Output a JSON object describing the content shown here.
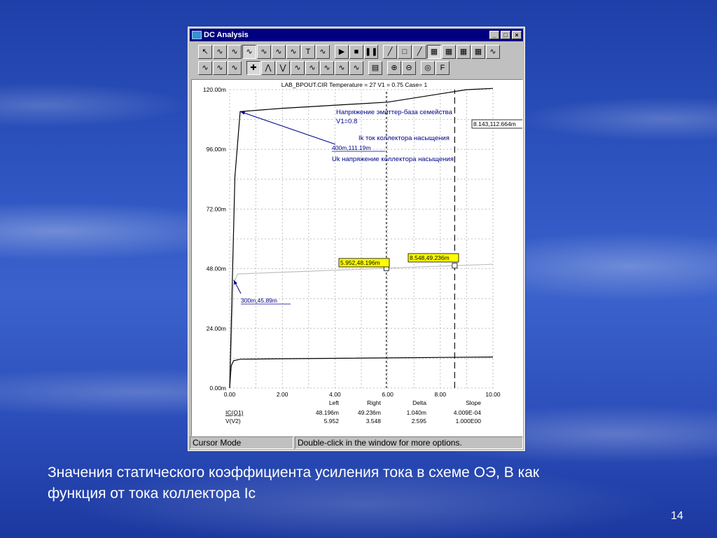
{
  "window": {
    "title": "DC Analysis",
    "controls": {
      "minimize": "_",
      "maximize": "□",
      "close": "×"
    }
  },
  "toolbar_row1": [
    "pointer-icon",
    "tool-icon",
    "tool-icon",
    "tool-icon",
    "tool-icon",
    "tool-icon",
    "tool-icon",
    "text-icon",
    "tool-icon",
    "play-icon",
    "stop-icon",
    "pause-icon",
    "line-icon",
    "box-icon",
    "line-icon",
    "grid-icon",
    "grid-icon",
    "grid-icon",
    "grid-icon",
    "tool-icon"
  ],
  "toolbar_row2": [
    "tool-icon",
    "tool-icon",
    "tool-icon",
    "cursor-icon",
    "peak-icon",
    "valley-icon",
    "tool-icon",
    "tool-icon",
    "tool-icon",
    "tool-icon",
    "tool-icon",
    "table-icon",
    "zoom-in-icon",
    "zoom-out-icon",
    "globe-icon",
    "font-icon"
  ],
  "chart_data": {
    "type": "line",
    "title": "LAB_BPOUT.CIR Temperature = 27 V1 = 0.75 Case= 1",
    "xlim": [
      0,
      10
    ],
    "ylim": [
      0,
      120
    ],
    "x_ticks": [
      "0.00",
      "2.00",
      "4.00",
      "6.00",
      "8.00",
      "10.00"
    ],
    "y_ticks": [
      "0.00m",
      "24.00m",
      "48.00m",
      "72.00m",
      "96.00m",
      "120.00m"
    ],
    "grid": true,
    "series": [
      {
        "points": [
          [
            0,
            0
          ],
          [
            0.06,
            9
          ],
          [
            0.15,
            11
          ],
          [
            0.4,
            11.6
          ],
          [
            2,
            11.8
          ],
          [
            10,
            12.5
          ]
        ],
        "color": "#000000"
      },
      {
        "points": [
          [
            0,
            0
          ],
          [
            0.15,
            42
          ],
          [
            0.3,
            45.89
          ],
          [
            2,
            46.6
          ],
          [
            5.952,
            48.196
          ],
          [
            8.548,
            49.236
          ],
          [
            10,
            49.8
          ]
        ],
        "color": "#c0c0c0"
      },
      {
        "points": [
          [
            0,
            0
          ],
          [
            0.2,
            85
          ],
          [
            0.4,
            111.19
          ],
          [
            2,
            112.5
          ],
          [
            6,
            115
          ],
          [
            9,
            120
          ],
          [
            10,
            120.5
          ]
        ],
        "color": "#000000"
      }
    ],
    "cursors": [
      {
        "x": 5.952,
        "style": "short-dash"
      },
      {
        "x": 8.548,
        "style": "long-dash"
      }
    ],
    "markers": [
      {
        "x": 5.952,
        "y": 48.196
      },
      {
        "x": 8.548,
        "y": 49.236
      }
    ],
    "labels": [
      {
        "text": "5.952,48.196m",
        "x": 5.952,
        "y": 48.196,
        "highlight": true
      },
      {
        "text": "8.548,49.236m",
        "x": 8.548,
        "y": 49.236,
        "highlight": true
      },
      {
        "text": "8.143,112.664m",
        "x": 8.143,
        "y": 112.664,
        "highlight": false
      },
      {
        "text": "400m,111.19m",
        "x": 0.4,
        "y": 111.19,
        "highlight": false
      },
      {
        "text": "300m,45.89m",
        "x": 0.3,
        "y": 45.89,
        "highlight": false
      }
    ],
    "annotations": [
      "Напряжение эмиттер-база семейства",
      "V1=0.8",
      "Ik ток коллектора насыщения",
      "Uk напряжение коллектора насыщения"
    ],
    "table": {
      "headers": [
        "",
        "Left",
        "Right",
        "Delta",
        "Slope"
      ],
      "rows": [
        [
          "IC(Q1)",
          "48.196m",
          "49.236m",
          "1.040m",
          "4.009E-04"
        ],
        [
          "V(V2)",
          "5.952",
          "3.548",
          "2.595",
          "1.000E00"
        ]
      ]
    }
  },
  "status": {
    "mode": "Cursor Mode",
    "hint": "Double-click in the window for more options."
  },
  "slide": {
    "caption_line1": "Значения статического коэффициента усиления тока в схеме ОЭ, В как",
    "caption_line2": "функция от тока коллектора Ic",
    "page_number": "14"
  }
}
